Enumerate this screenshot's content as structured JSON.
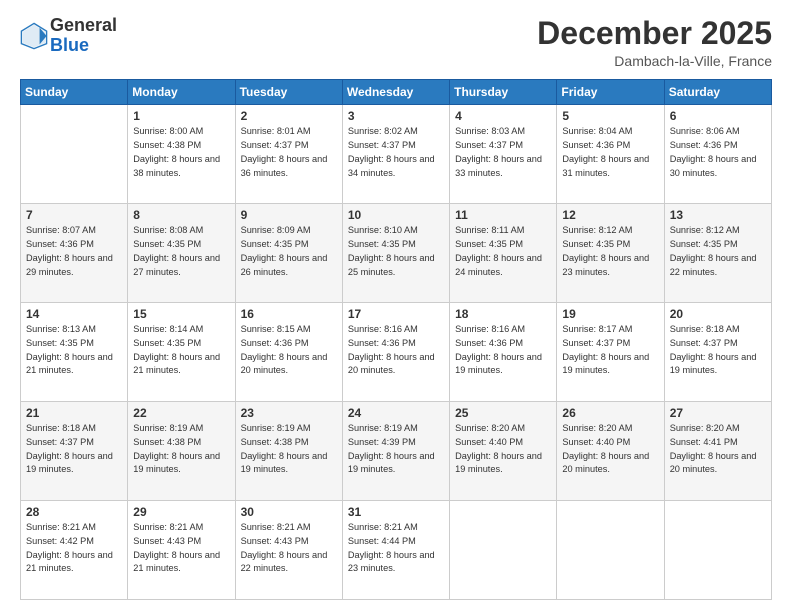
{
  "logo": {
    "general": "General",
    "blue": "Blue"
  },
  "header": {
    "month": "December 2025",
    "location": "Dambach-la-Ville, France"
  },
  "weekdays": [
    "Sunday",
    "Monday",
    "Tuesday",
    "Wednesday",
    "Thursday",
    "Friday",
    "Saturday"
  ],
  "weeks": [
    [
      {
        "day": "",
        "sunrise": "",
        "sunset": "",
        "daylight": ""
      },
      {
        "day": "1",
        "sunrise": "Sunrise: 8:00 AM",
        "sunset": "Sunset: 4:38 PM",
        "daylight": "Daylight: 8 hours and 38 minutes."
      },
      {
        "day": "2",
        "sunrise": "Sunrise: 8:01 AM",
        "sunset": "Sunset: 4:37 PM",
        "daylight": "Daylight: 8 hours and 36 minutes."
      },
      {
        "day": "3",
        "sunrise": "Sunrise: 8:02 AM",
        "sunset": "Sunset: 4:37 PM",
        "daylight": "Daylight: 8 hours and 34 minutes."
      },
      {
        "day": "4",
        "sunrise": "Sunrise: 8:03 AM",
        "sunset": "Sunset: 4:37 PM",
        "daylight": "Daylight: 8 hours and 33 minutes."
      },
      {
        "day": "5",
        "sunrise": "Sunrise: 8:04 AM",
        "sunset": "Sunset: 4:36 PM",
        "daylight": "Daylight: 8 hours and 31 minutes."
      },
      {
        "day": "6",
        "sunrise": "Sunrise: 8:06 AM",
        "sunset": "Sunset: 4:36 PM",
        "daylight": "Daylight: 8 hours and 30 minutes."
      }
    ],
    [
      {
        "day": "7",
        "sunrise": "Sunrise: 8:07 AM",
        "sunset": "Sunset: 4:36 PM",
        "daylight": "Daylight: 8 hours and 29 minutes."
      },
      {
        "day": "8",
        "sunrise": "Sunrise: 8:08 AM",
        "sunset": "Sunset: 4:35 PM",
        "daylight": "Daylight: 8 hours and 27 minutes."
      },
      {
        "day": "9",
        "sunrise": "Sunrise: 8:09 AM",
        "sunset": "Sunset: 4:35 PM",
        "daylight": "Daylight: 8 hours and 26 minutes."
      },
      {
        "day": "10",
        "sunrise": "Sunrise: 8:10 AM",
        "sunset": "Sunset: 4:35 PM",
        "daylight": "Daylight: 8 hours and 25 minutes."
      },
      {
        "day": "11",
        "sunrise": "Sunrise: 8:11 AM",
        "sunset": "Sunset: 4:35 PM",
        "daylight": "Daylight: 8 hours and 24 minutes."
      },
      {
        "day": "12",
        "sunrise": "Sunrise: 8:12 AM",
        "sunset": "Sunset: 4:35 PM",
        "daylight": "Daylight: 8 hours and 23 minutes."
      },
      {
        "day": "13",
        "sunrise": "Sunrise: 8:12 AM",
        "sunset": "Sunset: 4:35 PM",
        "daylight": "Daylight: 8 hours and 22 minutes."
      }
    ],
    [
      {
        "day": "14",
        "sunrise": "Sunrise: 8:13 AM",
        "sunset": "Sunset: 4:35 PM",
        "daylight": "Daylight: 8 hours and 21 minutes."
      },
      {
        "day": "15",
        "sunrise": "Sunrise: 8:14 AM",
        "sunset": "Sunset: 4:35 PM",
        "daylight": "Daylight: 8 hours and 21 minutes."
      },
      {
        "day": "16",
        "sunrise": "Sunrise: 8:15 AM",
        "sunset": "Sunset: 4:36 PM",
        "daylight": "Daylight: 8 hours and 20 minutes."
      },
      {
        "day": "17",
        "sunrise": "Sunrise: 8:16 AM",
        "sunset": "Sunset: 4:36 PM",
        "daylight": "Daylight: 8 hours and 20 minutes."
      },
      {
        "day": "18",
        "sunrise": "Sunrise: 8:16 AM",
        "sunset": "Sunset: 4:36 PM",
        "daylight": "Daylight: 8 hours and 19 minutes."
      },
      {
        "day": "19",
        "sunrise": "Sunrise: 8:17 AM",
        "sunset": "Sunset: 4:37 PM",
        "daylight": "Daylight: 8 hours and 19 minutes."
      },
      {
        "day": "20",
        "sunrise": "Sunrise: 8:18 AM",
        "sunset": "Sunset: 4:37 PM",
        "daylight": "Daylight: 8 hours and 19 minutes."
      }
    ],
    [
      {
        "day": "21",
        "sunrise": "Sunrise: 8:18 AM",
        "sunset": "Sunset: 4:37 PM",
        "daylight": "Daylight: 8 hours and 19 minutes."
      },
      {
        "day": "22",
        "sunrise": "Sunrise: 8:19 AM",
        "sunset": "Sunset: 4:38 PM",
        "daylight": "Daylight: 8 hours and 19 minutes."
      },
      {
        "day": "23",
        "sunrise": "Sunrise: 8:19 AM",
        "sunset": "Sunset: 4:38 PM",
        "daylight": "Daylight: 8 hours and 19 minutes."
      },
      {
        "day": "24",
        "sunrise": "Sunrise: 8:19 AM",
        "sunset": "Sunset: 4:39 PM",
        "daylight": "Daylight: 8 hours and 19 minutes."
      },
      {
        "day": "25",
        "sunrise": "Sunrise: 8:20 AM",
        "sunset": "Sunset: 4:40 PM",
        "daylight": "Daylight: 8 hours and 19 minutes."
      },
      {
        "day": "26",
        "sunrise": "Sunrise: 8:20 AM",
        "sunset": "Sunset: 4:40 PM",
        "daylight": "Daylight: 8 hours and 20 minutes."
      },
      {
        "day": "27",
        "sunrise": "Sunrise: 8:20 AM",
        "sunset": "Sunset: 4:41 PM",
        "daylight": "Daylight: 8 hours and 20 minutes."
      }
    ],
    [
      {
        "day": "28",
        "sunrise": "Sunrise: 8:21 AM",
        "sunset": "Sunset: 4:42 PM",
        "daylight": "Daylight: 8 hours and 21 minutes."
      },
      {
        "day": "29",
        "sunrise": "Sunrise: 8:21 AM",
        "sunset": "Sunset: 4:43 PM",
        "daylight": "Daylight: 8 hours and 21 minutes."
      },
      {
        "day": "30",
        "sunrise": "Sunrise: 8:21 AM",
        "sunset": "Sunset: 4:43 PM",
        "daylight": "Daylight: 8 hours and 22 minutes."
      },
      {
        "day": "31",
        "sunrise": "Sunrise: 8:21 AM",
        "sunset": "Sunset: 4:44 PM",
        "daylight": "Daylight: 8 hours and 23 minutes."
      },
      {
        "day": "",
        "sunrise": "",
        "sunset": "",
        "daylight": ""
      },
      {
        "day": "",
        "sunrise": "",
        "sunset": "",
        "daylight": ""
      },
      {
        "day": "",
        "sunrise": "",
        "sunset": "",
        "daylight": ""
      }
    ]
  ]
}
